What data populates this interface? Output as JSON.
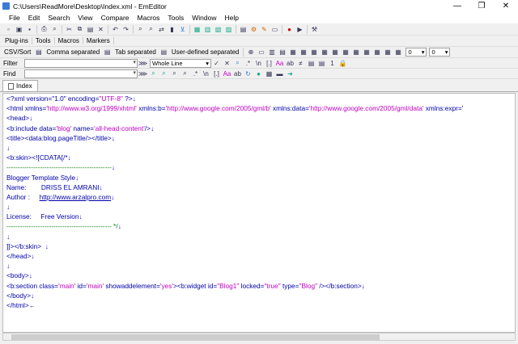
{
  "window": {
    "title": "C:\\Users\\ReadMore\\Desktop\\Index.xml - EmEditor"
  },
  "menu": [
    "File",
    "Edit",
    "Search",
    "View",
    "Compare",
    "Macros",
    "Tools",
    "Window",
    "Help"
  ],
  "panels": [
    "Plug-ins",
    "Tools",
    "Macros",
    "Markers"
  ],
  "csv": {
    "sort_label": "CSV/Sort",
    "comma": "Comma separated",
    "tab": "Tab separated",
    "user": "User-defined separated",
    "combo1": "0",
    "combo2": "0"
  },
  "filter": {
    "label": "Filter",
    "mode": "Whole Line"
  },
  "find": {
    "label": "Find"
  },
  "tabs": [
    {
      "label": "Index"
    }
  ],
  "editor_lines": [
    [
      {
        "t": "<?xml version=\"1.0\" encoding=",
        "c": "attr"
      },
      {
        "t": "\"UTF-8\"",
        "c": "str"
      },
      {
        "t": " ?>",
        "c": "attr"
      },
      {
        "t": "↓",
        "c": "nl"
      }
    ],
    [
      {
        "t": "<html xmlns=",
        "c": "attr"
      },
      {
        "t": "'http://www.w3.org/1999/xhtml'",
        "c": "str"
      },
      {
        "t": " xmlns:b=",
        "c": "attr"
      },
      {
        "t": "'http://www.google.com/2005/gml/b'",
        "c": "str"
      },
      {
        "t": " xmlns:data=",
        "c": "attr"
      },
      {
        "t": "'http://www.google.com/2005/gml/data'",
        "c": "str"
      },
      {
        "t": " xmlns:expr='",
        "c": "attr"
      }
    ],
    [
      {
        "t": "<head>",
        "c": "attr"
      },
      {
        "t": "↓",
        "c": "nl"
      }
    ],
    [
      {
        "t": "<b:include data=",
        "c": "attr"
      },
      {
        "t": "'blog'",
        "c": "str"
      },
      {
        "t": " name=",
        "c": "attr"
      },
      {
        "t": "'all-head-content'",
        "c": "str"
      },
      {
        "t": "/>",
        "c": "attr"
      },
      {
        "t": "↓",
        "c": "nl"
      }
    ],
    [
      {
        "t": "<title><data:blog.pageTitle/></title>",
        "c": "attr"
      },
      {
        "t": "↓",
        "c": "nl"
      }
    ],
    [
      {
        "t": "↓",
        "c": "nl"
      }
    ],
    [
      {
        "t": "<b:skin><![CDATA[/*",
        "c": "attr"
      },
      {
        "t": "↓",
        "c": "nl"
      }
    ],
    [
      {
        "t": "-----------------------------------------------",
        "c": "dash"
      },
      {
        "t": "↓",
        "c": "nl"
      }
    ],
    [
      {
        "t": "Blogger Template Style",
        "c": "attr"
      },
      {
        "t": "↓",
        "c": "nl"
      }
    ],
    [
      {
        "t": "Name:        DRISS EL AMRANI",
        "c": "attr"
      },
      {
        "t": "↓",
        "c": "nl"
      }
    ],
    [
      {
        "t": "Author :     ",
        "c": "attr"
      },
      {
        "t": "http://www.arzalpro.com",
        "c": "link"
      },
      {
        "t": "↓",
        "c": "nl"
      }
    ],
    [
      {
        "t": "↓",
        "c": "nl"
      }
    ],
    [
      {
        "t": "License:     Free Version",
        "c": "attr"
      },
      {
        "t": "↓",
        "c": "nl"
      }
    ],
    [
      {
        "t": "----------------------------------------------- */",
        "c": "dash"
      },
      {
        "t": "↓",
        "c": "nl"
      }
    ],
    [
      {
        "t": "↓",
        "c": "nl"
      }
    ],
    [
      {
        "t": "]]></b:skin>  ",
        "c": "attr"
      },
      {
        "t": "↓",
        "c": "nl"
      }
    ],
    [
      {
        "t": "</head>",
        "c": "attr"
      },
      {
        "t": "↓",
        "c": "nl"
      }
    ],
    [
      {
        "t": "↓",
        "c": "nl"
      }
    ],
    [
      {
        "t": "<body>",
        "c": "attr"
      },
      {
        "t": "↓",
        "c": "nl"
      }
    ],
    [
      {
        "t": "<b:section class=",
        "c": "attr"
      },
      {
        "t": "'main'",
        "c": "str"
      },
      {
        "t": " id=",
        "c": "attr"
      },
      {
        "t": "'main'",
        "c": "str"
      },
      {
        "t": " showaddelement=",
        "c": "attr"
      },
      {
        "t": "'yes'",
        "c": "str"
      },
      {
        "t": "><b:widget id=",
        "c": "attr"
      },
      {
        "t": "\"Blog1\"",
        "c": "str"
      },
      {
        "t": " locked=",
        "c": "attr"
      },
      {
        "t": "\"true\"",
        "c": "str"
      },
      {
        "t": " type=",
        "c": "attr"
      },
      {
        "t": "\"Blog\"",
        "c": "str"
      },
      {
        "t": " /></b:section>",
        "c": "attr"
      },
      {
        "t": "↓",
        "c": "nl"
      }
    ],
    [
      {
        "t": "</body>",
        "c": "attr"
      },
      {
        "t": "↓",
        "c": "nl"
      }
    ],
    [
      {
        "t": "</html>",
        "c": "attr"
      },
      {
        "t": "←",
        "c": "nl"
      }
    ]
  ]
}
